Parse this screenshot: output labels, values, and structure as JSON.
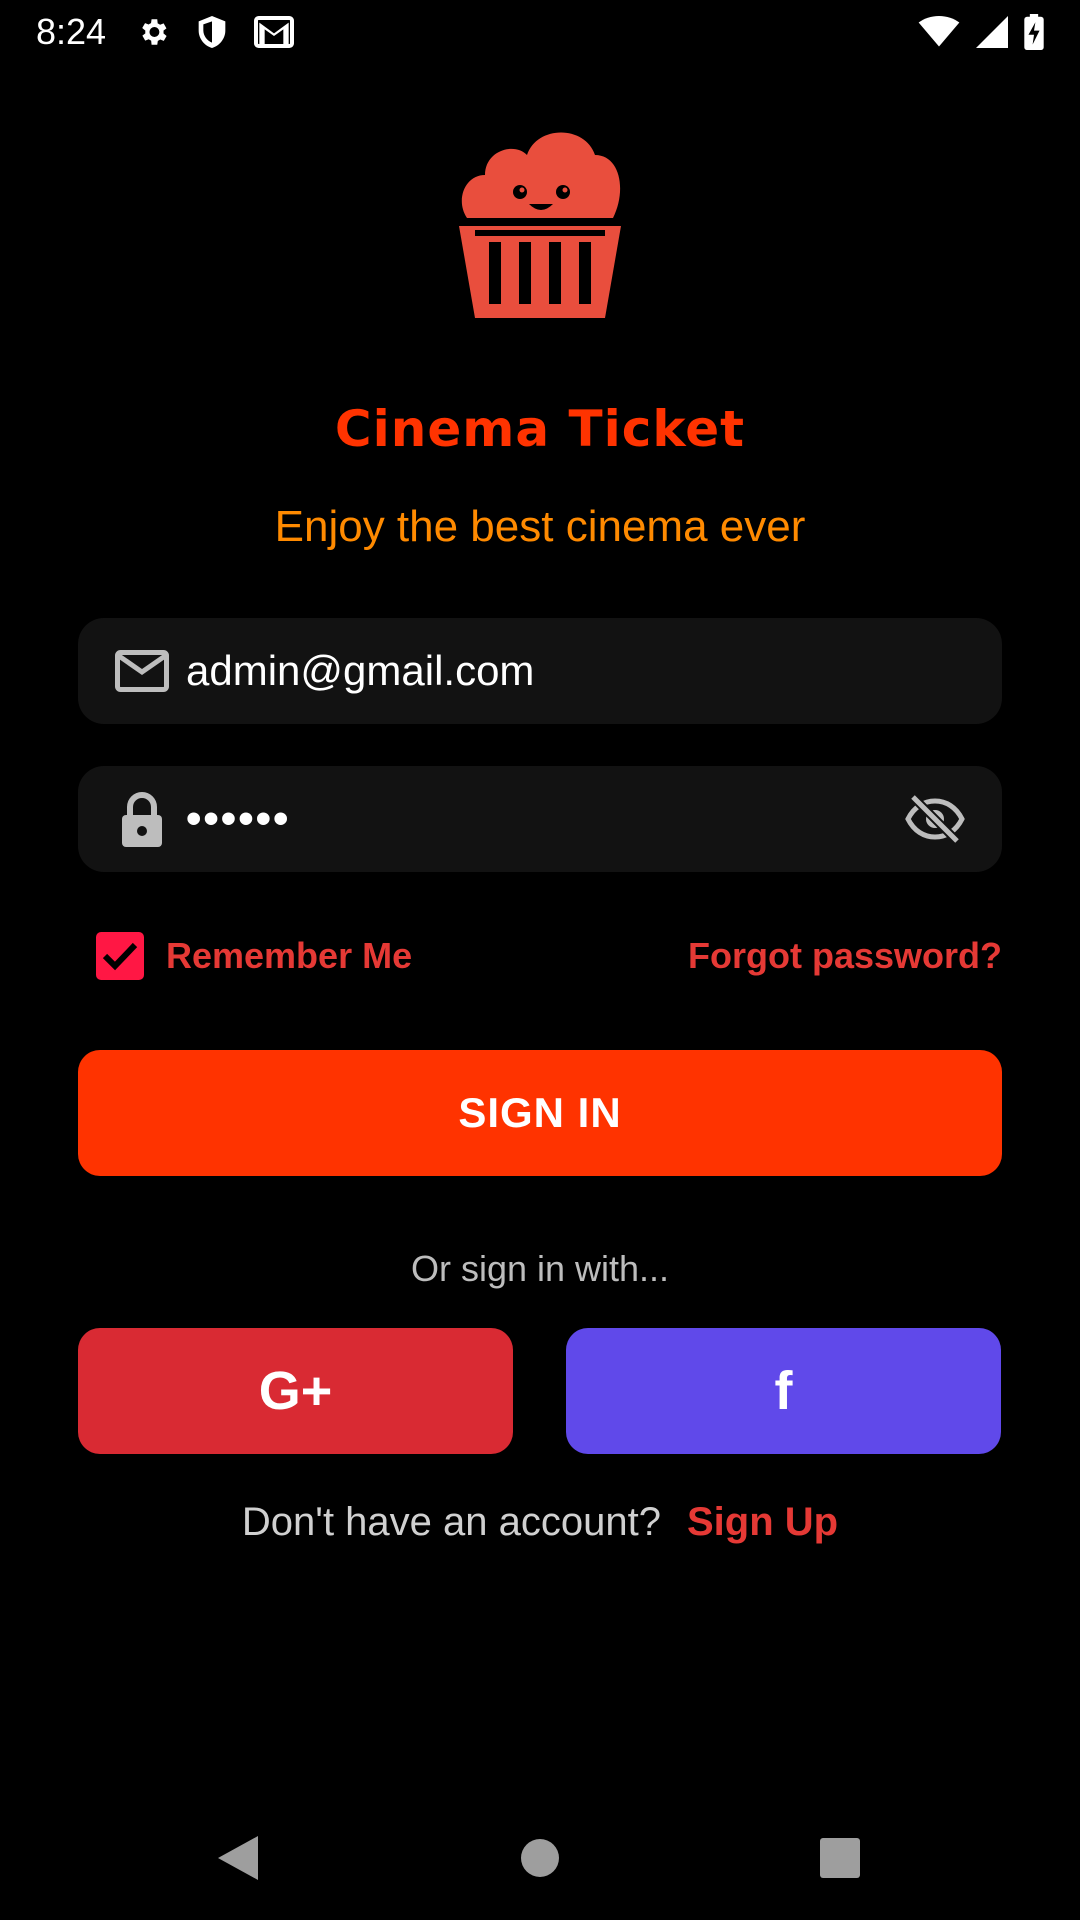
{
  "status_bar": {
    "time": "8:24",
    "icons": [
      "settings-icon",
      "shield-icon",
      "gmail-icon",
      "wifi-icon",
      "signal-icon",
      "battery-charging-icon"
    ]
  },
  "branding": {
    "logo_icon": "popcorn-mascot-icon",
    "title": "Cinema Ticket",
    "tagline": "Enjoy the best cinema ever",
    "colors": {
      "title": "#ff3300",
      "tagline": "#ff8a00",
      "logo": "#e94e3d"
    }
  },
  "form": {
    "email": {
      "value": "admin@gmail.com",
      "icon": "mail-icon"
    },
    "password": {
      "value": "••••••",
      "icon": "lock-icon",
      "toggle_icon": "eye-off-icon"
    },
    "remember_me": {
      "label": "Remember Me",
      "checked": true
    },
    "forgot_password": "Forgot password?",
    "sign_in": "SIGN IN"
  },
  "social": {
    "prompt": "Or sign in with...",
    "google_label": "G+",
    "facebook_label": "f",
    "colors": {
      "google": "#d92a33",
      "facebook": "#6049ea"
    }
  },
  "signup": {
    "prompt": "Don't have an account?",
    "link": "Sign Up"
  },
  "nav_bar": {
    "icons": [
      "back-icon",
      "home-icon",
      "recents-icon"
    ]
  },
  "accent": "#ff3300"
}
